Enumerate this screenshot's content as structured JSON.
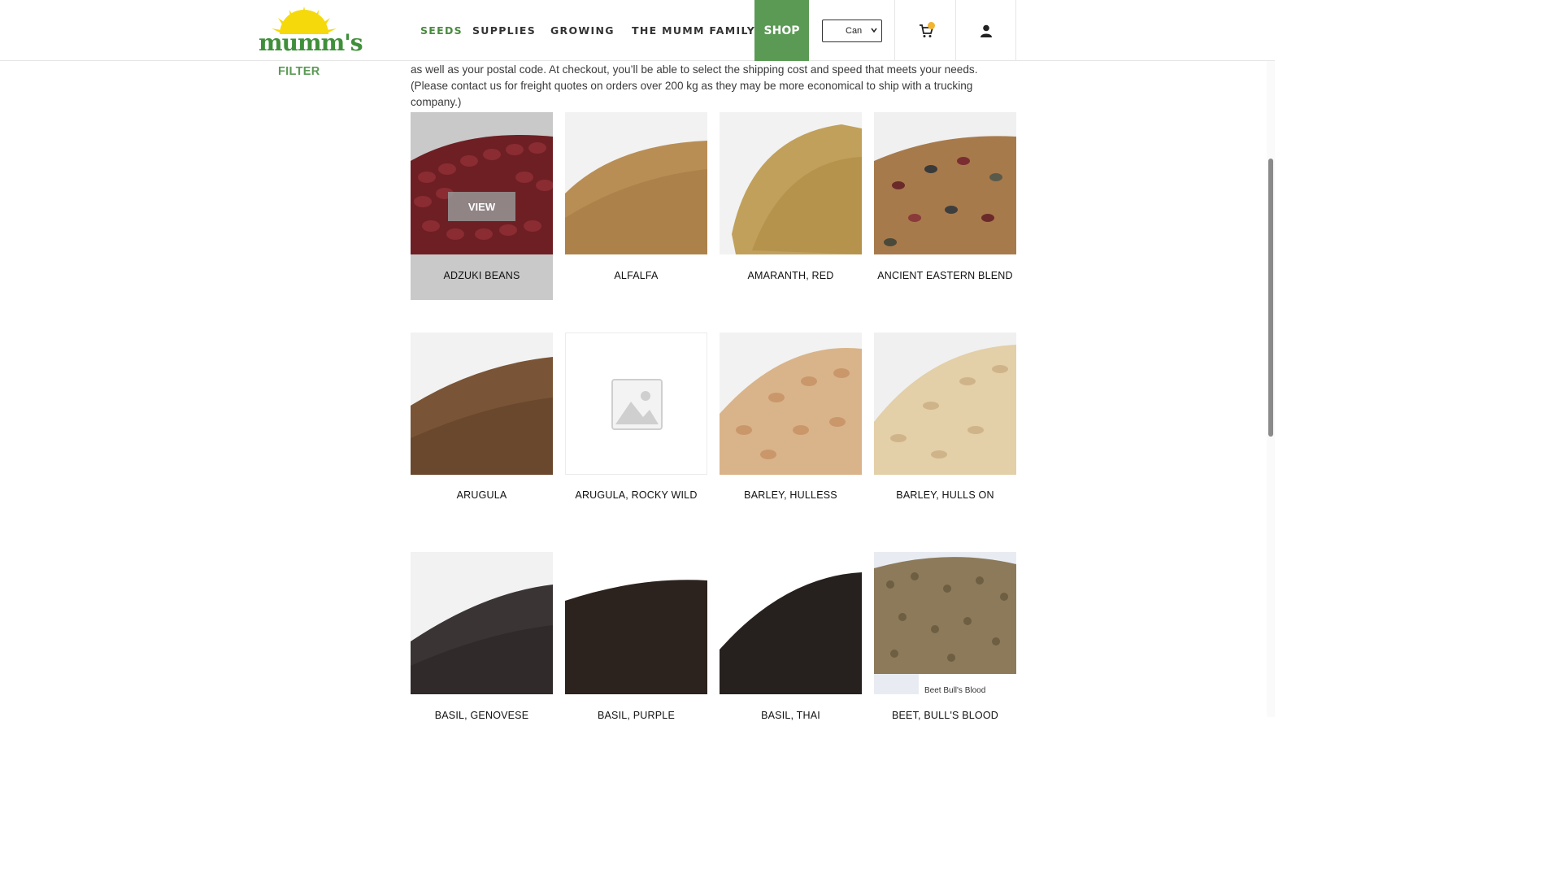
{
  "header": {
    "logo_text": "mumm's",
    "nav": [
      {
        "label": "SEEDS",
        "active": true
      },
      {
        "label": "SUPPLIES",
        "active": false
      },
      {
        "label": "GROWING",
        "active": false
      },
      {
        "label": "THE MUMM FAMILY",
        "active": false
      }
    ],
    "shop_label": "SHOP",
    "currency_value": "Can",
    "cart_icon": "cart-icon",
    "account_icon": "user-icon"
  },
  "sidebar": {
    "filter_label": "FILTER"
  },
  "intro_text": "as well as your postal code. At checkout, you’ll be able to select the shipping cost and speed that meets your needs. (Please contact us for freight quotes on orders over 200 kg as they may be more economical to ship with a trucking company.)",
  "products": [
    {
      "name": "ADZUKI BEANS",
      "hover": true,
      "view_label": "VIEW"
    },
    {
      "name": "ALFALFA"
    },
    {
      "name": "AMARANTH, RED"
    },
    {
      "name": "ANCIENT EASTERN BLEND"
    },
    {
      "name": "ARUGULA"
    },
    {
      "name": "ARUGULA, ROCKY WILD"
    },
    {
      "name": "BARLEY, HULLESS"
    },
    {
      "name": "BARLEY, HULLS ON"
    },
    {
      "name": "BASIL, GENOVESE"
    },
    {
      "name": "BASIL, PURPLE"
    },
    {
      "name": "BASIL, THAI"
    },
    {
      "name": "BEET, BULL'S BLOOD",
      "image_caption": "Beet Bull's Blood"
    }
  ],
  "colors": {
    "brand_green": "#5b9a55",
    "logo_yellow": "#f5d90a",
    "cart_badge": "#f2b431"
  }
}
